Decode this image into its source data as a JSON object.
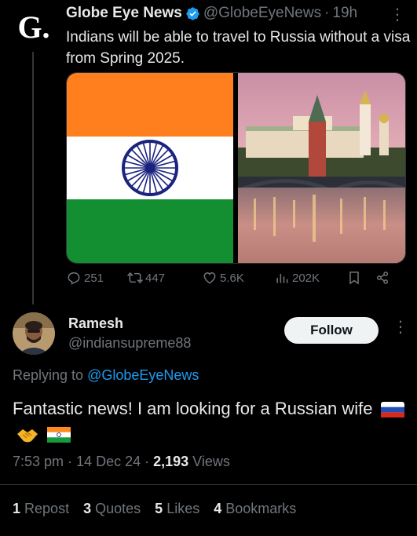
{
  "parent_tweet": {
    "avatar_letter": "G.",
    "author_name": "Globe Eye News",
    "handle": "@GlobeEyeNews",
    "separator": "·",
    "time": "19h",
    "text": "Indians will be able to travel to Russia without a visa from Spring 2025.",
    "actions": {
      "replies": "251",
      "reposts": "447",
      "likes": "5.6K",
      "views": "202K"
    },
    "colors": {
      "saffron": "#ff7f1f",
      "green": "#138f31",
      "chakra": "#1a237e"
    }
  },
  "reply": {
    "author_name": "Ramesh",
    "handle": "@indiansupreme88",
    "follow_label": "Follow",
    "replying_prefix": "Replying to",
    "replying_to": "@GlobeEyeNews",
    "text": "Fantastic news! I am looking for a Russian wife",
    "emojis": [
      "russia-flag",
      "handshake",
      "india-flag"
    ],
    "time": "7:53 pm",
    "date": "14 Dec 24",
    "views_count": "2,193",
    "views_label": "Views",
    "stats": [
      {
        "count": "1",
        "label": "Repost"
      },
      {
        "count": "3",
        "label": "Quotes"
      },
      {
        "count": "5",
        "label": "Likes"
      },
      {
        "count": "4",
        "label": "Bookmarks"
      }
    ]
  },
  "theme": {
    "accent": "#1d9bf0",
    "muted": "#71767b",
    "text": "#e7e9ea"
  }
}
